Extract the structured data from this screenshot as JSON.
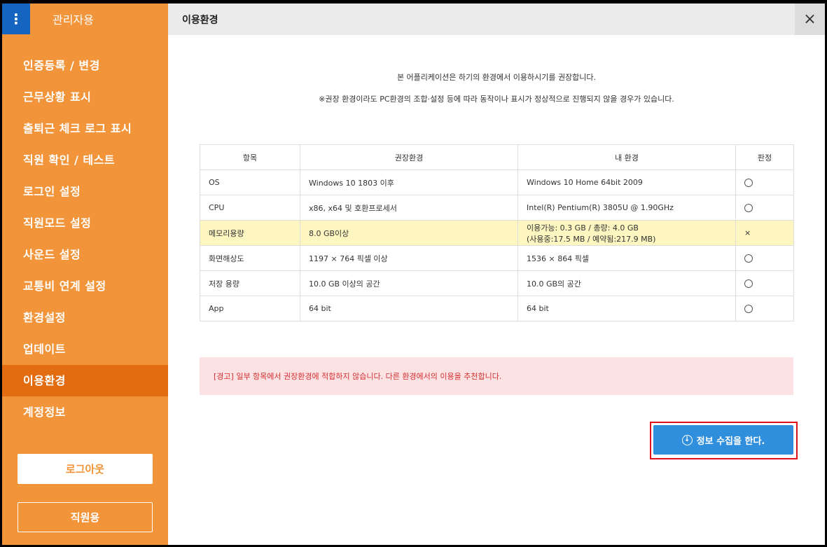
{
  "sidebar": {
    "title": "관리자용",
    "items": [
      {
        "label": "인증등록 / 변경"
      },
      {
        "label": "근무상황 표시"
      },
      {
        "label": "출퇴근 체크 로그 표시"
      },
      {
        "label": "직원 확인 / 테스트"
      },
      {
        "label": "로그인 설정"
      },
      {
        "label": "직원모드 설정"
      },
      {
        "label": "사운드 설정"
      },
      {
        "label": "교통비 연계 설정"
      },
      {
        "label": "환경설정"
      },
      {
        "label": "업데이트"
      },
      {
        "label": "이용환경",
        "active": true
      },
      {
        "label": "계정정보"
      }
    ],
    "logout_label": "로그아웃",
    "staff_label": "직원용"
  },
  "header": {
    "title": "이용환경",
    "close_icon": "×"
  },
  "intro": {
    "line1": "본 어플리케이션은 하기의 환경에서 이용하시기를 권장합니다.",
    "line2": "※권장 환경이라도 PC환경의 조합·설정 등에 따라 동작이나 표시가 정상적으로 진행되지 않을 경우가 있습니다."
  },
  "table": {
    "headers": [
      "항목",
      "권장환경",
      "내 환경",
      "판정"
    ],
    "rows": [
      {
        "item": "OS",
        "recommended": "Windows 10 1803 이후",
        "mine_line1": "Windows 10 Home 64bit 2009",
        "mine_line2": "",
        "judge": "ok"
      },
      {
        "item": "CPU",
        "recommended": "x86, x64 및 호환프로세서",
        "mine_line1": "Intel(R) Pentium(R) 3805U @ 1.90GHz",
        "mine_line2": "",
        "judge": "ok"
      },
      {
        "item": "메모리용량",
        "recommended": "8.0 GB이상",
        "mine_line1": "이용가능: 0.3 GB / 총량: 4.0 GB",
        "mine_line2": "(사용중:17.5 MB / 예약됨:217.9 MB)",
        "judge": "ng",
        "judge_text": "×"
      },
      {
        "item": "화면해상도",
        "recommended": "1197 × 764 픽셀 이상",
        "mine_line1": "1536 × 864 픽셀",
        "mine_line2": "",
        "judge": "ok"
      },
      {
        "item": "저장 용량",
        "recommended": "10.0 GB 이상의 공간",
        "mine_line1": "10.0 GB의 공간",
        "mine_line2": "",
        "judge": "ok"
      },
      {
        "item": "App",
        "recommended": "64 bit",
        "mine_line1": "64 bit",
        "mine_line2": "",
        "judge": "ok"
      }
    ]
  },
  "alert": {
    "text": "[경고] 일부 항목에서 권장환경에 적합하지 않습니다. 다른 환경에서의 이용을 추천합니다."
  },
  "collect": {
    "label": "정보 수집을 한다.",
    "icon_glyph": "↓"
  },
  "colors": {
    "sidebar": "#f2943a",
    "sidebar_active": "#e26c0f",
    "menu_button": "#1565c0",
    "primary_button": "#2f8fdd",
    "highlight_frame": "#e0101a",
    "alert_bg": "#fde2e4",
    "alert_text": "#d32f2f",
    "warn_row": "#fef6c1"
  }
}
